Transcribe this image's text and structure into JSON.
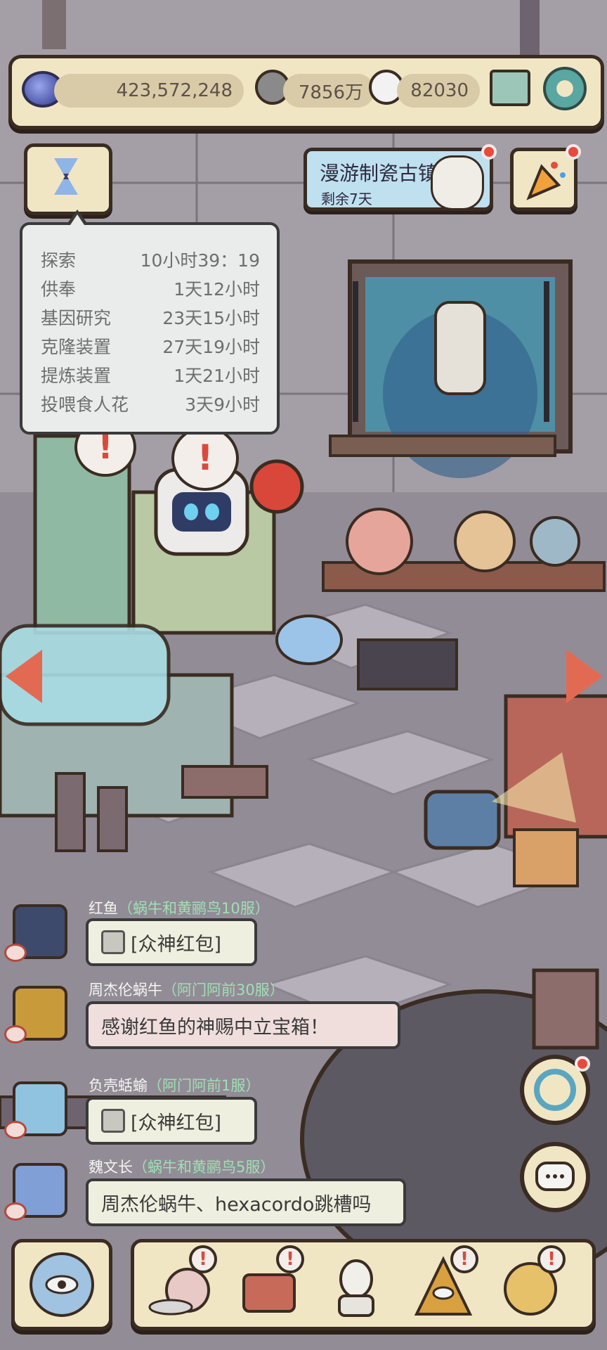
{
  "currency": {
    "gems": "423,572,248",
    "coins": "7856万",
    "tokens": "82030"
  },
  "event": {
    "title": "漫游制瓷古镇",
    "remaining": "剩余7天"
  },
  "timers": [
    {
      "label": "探索",
      "value": "10小时39：19"
    },
    {
      "label": "供奉",
      "value": "1天12小时"
    },
    {
      "label": "基因研究",
      "value": "23天15小时"
    },
    {
      "label": "克隆装置",
      "value": "27天19小时"
    },
    {
      "label": "提炼装置",
      "value": "1天21小时"
    },
    {
      "label": "投喂食人花",
      "value": "3天9小时"
    }
  ],
  "chat": [
    {
      "name": "红鱼",
      "server": "（蜗牛和黄鹂鸟10服）",
      "message": "[众神红包]"
    },
    {
      "name": "周杰伦蜗牛",
      "server": "（阿门阿前30服）",
      "message": "感谢红鱼的神赐中立宝箱！"
    },
    {
      "name": "负壳蛞蝓",
      "server": "（阿门阿前1服）",
      "message": "[众神红包]"
    },
    {
      "name": "魏文长",
      "server": "（蜗牛和黄鹂鸟5服）",
      "message": "周杰伦蜗牛、hexacordo跳槽吗"
    }
  ],
  "colors": {
    "panel": "#f1e6c4",
    "outline": "#3a2c22",
    "alert": "#e84a3c",
    "arrow": "#e36a52",
    "server_text": "#9fe0b2"
  }
}
